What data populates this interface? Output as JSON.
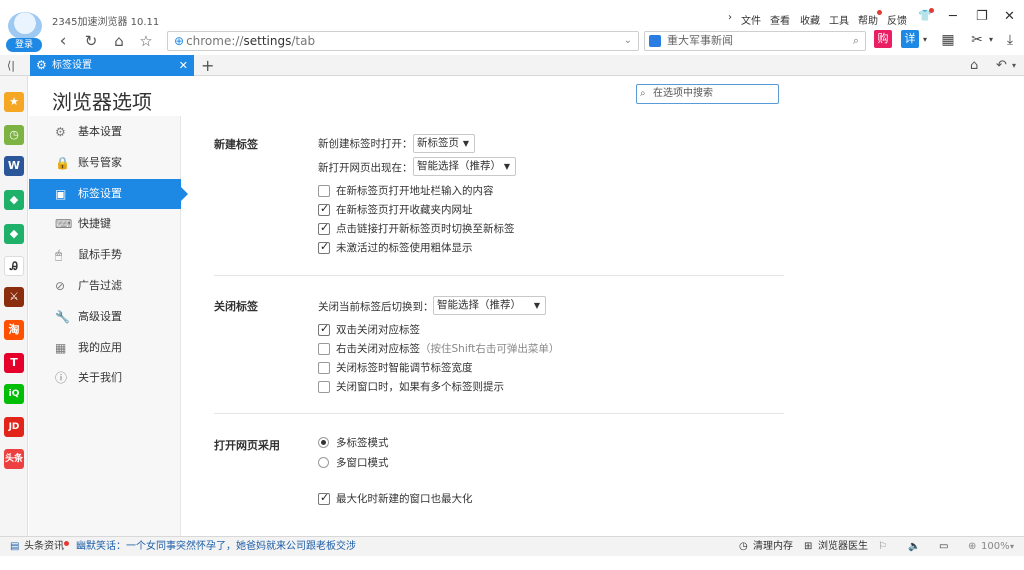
{
  "browser": {
    "app_title": "2345加速浏览器 10.11",
    "login_label": "登录",
    "address": {
      "scheme": "chrome://",
      "host": "settings",
      "path": "/tab"
    },
    "search_placeholder": "重大军事新闻",
    "menu": {
      "file": "文件",
      "view": "查看",
      "favorites": "收藏",
      "tools": "工具",
      "help": "帮助",
      "feedback": "反馈"
    },
    "window_controls": {
      "skin": "👕",
      "minimize": "─",
      "restore": "❐",
      "close": "✕"
    },
    "toolbar_icons": {
      "buy": "购",
      "detail": "详"
    }
  },
  "tabs": [
    {
      "title": "标签设置",
      "active": true
    }
  ],
  "rail_apps": [
    {
      "name": "favorites-star",
      "label": "★",
      "color": "#f5a623"
    },
    {
      "name": "history-clock",
      "label": "◷",
      "color": "#7cb342"
    },
    {
      "name": "word-doc",
      "label": "W",
      "color": "#2b579a"
    },
    {
      "name": "shield-app-1",
      "label": "◆",
      "color": "#1fb16a"
    },
    {
      "name": "shield-app-2",
      "label": "◆",
      "color": "#1fb16a"
    },
    {
      "name": "font-app",
      "label": "Ꭿ",
      "color": "#ffffff"
    },
    {
      "name": "game-app",
      "label": "⚔",
      "color": "#8a2e0f"
    },
    {
      "name": "taobao-app",
      "label": "淘",
      "color": "#ff5000"
    },
    {
      "name": "tmall-app",
      "label": "T",
      "color": "#e4002b"
    },
    {
      "name": "iqiyi-app",
      "label": "iQ",
      "color": "#00be06"
    },
    {
      "name": "jd-app",
      "label": "JD",
      "color": "#e1251b"
    },
    {
      "name": "toutiao-app",
      "label": "头条",
      "color": "#ed4040"
    }
  ],
  "settings": {
    "page_title": "浏览器选项",
    "search_placeholder": "在选项中搜索",
    "nav": [
      {
        "label": "基本设置",
        "icon": "⚙"
      },
      {
        "label": "账号管家",
        "icon": "🔒"
      },
      {
        "label": "标签设置",
        "icon": "▣",
        "active": true
      },
      {
        "label": "快捷键",
        "icon": "⌨"
      },
      {
        "label": "鼠标手势",
        "icon": "🖱"
      },
      {
        "label": "广告过滤",
        "icon": "⊘"
      },
      {
        "label": "高级设置",
        "icon": "🔧"
      },
      {
        "label": "我的应用",
        "icon": "▦"
      },
      {
        "label": "关于我们",
        "icon": "ⓘ"
      }
    ],
    "new_tab": {
      "title": "新建标签",
      "open_label": "新创建标签时打开：",
      "open_value": "新标签页",
      "position_label": "新打开网页出现在：",
      "position_value": "智能选择（推荐）",
      "options": [
        {
          "label": "在新标签页打开地址栏输入的内容",
          "checked": false
        },
        {
          "label": "在新标签页打开收藏夹内网址",
          "checked": true
        },
        {
          "label": "点击链接打开新标签页时切换至新标签",
          "checked": true
        },
        {
          "label": "未激活过的标签使用粗体显示",
          "checked": true
        }
      ]
    },
    "close_tab": {
      "title": "关闭标签",
      "switch_label": "关闭当前标签后切换到：",
      "switch_value": "智能选择（推荐）",
      "options": [
        {
          "label": "双击关闭对应标签",
          "checked": true,
          "hint": ""
        },
        {
          "label": "右击关闭对应标签",
          "checked": false,
          "hint": "（按住Shift右击可弹出菜单）"
        },
        {
          "label": "关闭标签时智能调节标签宽度",
          "checked": false,
          "hint": ""
        },
        {
          "label": "关闭窗口时，如果有多个标签则提示",
          "checked": false,
          "hint": ""
        }
      ]
    },
    "open_mode": {
      "title": "打开网页采用",
      "modes": [
        {
          "label": "多标签模式",
          "checked": true
        },
        {
          "label": "多窗口模式",
          "checked": false
        }
      ],
      "maximize_option": {
        "label": "最大化时新建的窗口也最大化",
        "checked": true
      }
    }
  },
  "statusbar": {
    "news_label": "头条资讯",
    "news_text": "幽默笑话：一个女同事突然怀孕了，她爸妈就来公司跟老板交涉",
    "clear_memory": "清理内存",
    "browser_doctor": "浏览器医生",
    "zoom": "100%"
  }
}
